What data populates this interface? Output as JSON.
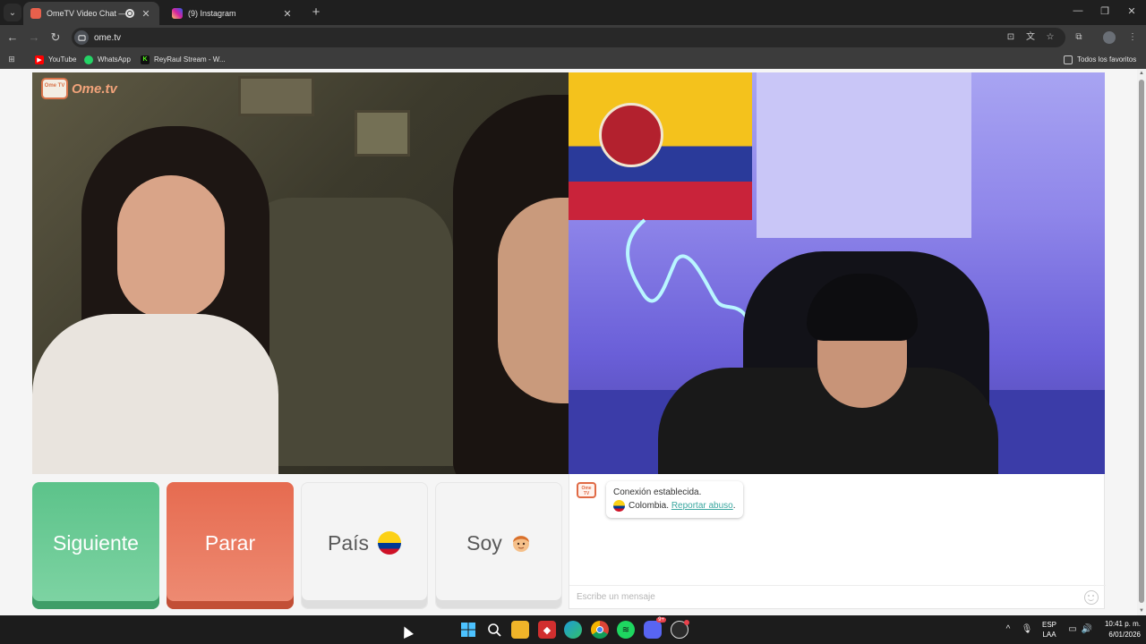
{
  "browser": {
    "tabs": [
      {
        "title": "OmeTV Video Chat — Ome",
        "active": true,
        "favicon_color": "#e8604c",
        "recording": true
      },
      {
        "title": "(9) Instagram",
        "active": false,
        "favicon_color": "#d6249f"
      }
    ],
    "url": "ome.tv",
    "bookmarks": [
      {
        "label": "YouTube",
        "icon": "youtube-icon",
        "color": "#ff0000"
      },
      {
        "label": "WhatsApp",
        "icon": "whatsapp-icon",
        "color": "#25d366"
      },
      {
        "label": "ReyRaul Stream - W...",
        "icon": "kick-icon",
        "color": "#53fc18"
      }
    ],
    "all_bookmarks_label": "Todos los favoritos"
  },
  "site": {
    "logo_badge": "Ome TV",
    "logo_text": "Ome.tv",
    "controls": {
      "next_label": "Siguiente",
      "stop_label": "Parar",
      "country_label": "País",
      "gender_label": "Soy"
    },
    "chat": {
      "avatar_text": "Ome TV",
      "status_message": "Conexión establecida.",
      "country_prefix": "Colombia.",
      "report_link": "Reportar abuso",
      "report_suffix": ".",
      "input_placeholder": "Escribe un mensaje"
    },
    "colors": {
      "next": "#5cc38a",
      "stop": "#e66b50",
      "link": "#3aa7a0"
    }
  },
  "taskbar": {
    "apps": [
      "windows-start-icon",
      "search-icon",
      "file-explorer-icon",
      "media-app-icon",
      "edge-icon",
      "chrome-icon",
      "spotify-icon",
      "discord-icon",
      "obs-icon"
    ],
    "discord_badge": "9+",
    "lang_line1": "ESP",
    "lang_line2": "LAA",
    "time": "10:41 p. m.",
    "date": "6/01/2026"
  }
}
